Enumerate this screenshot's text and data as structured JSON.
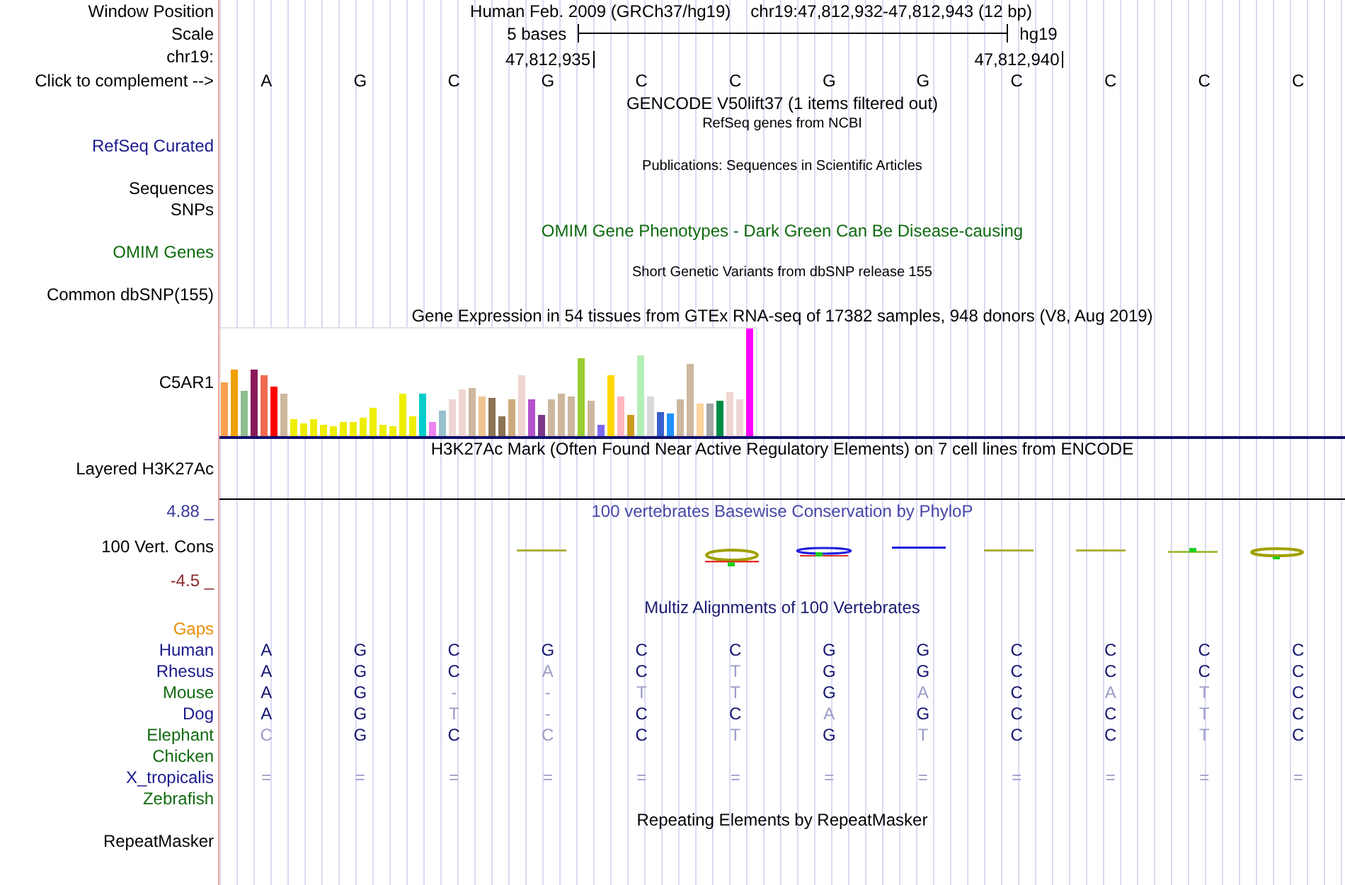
{
  "header": {
    "window_label": "Window Position",
    "assembly_title": "Human Feb. 2009 (GRCh37/hg19)",
    "position": "chr19:47,812,932-47,812,943 (12 bp)",
    "scale_label": "Scale",
    "scale_text": "5 bases",
    "assembly": "hg19",
    "chrom_label": "chr19:",
    "ticks": [
      {
        "label": "47,812,935"
      },
      {
        "label": "47,812,940"
      }
    ],
    "complement_label": "Click to complement -->",
    "bases": [
      "A",
      "G",
      "C",
      "G",
      "C",
      "C",
      "G",
      "G",
      "C",
      "C",
      "C",
      "C"
    ]
  },
  "tracks": [
    {
      "kind": "title",
      "text": "GENCODE V50lift37 (1 items filtered out)"
    },
    {
      "kind": "subtitle",
      "text": "RefSeq genes from NCBI"
    },
    {
      "kind": "label",
      "label": "RefSeq Curated",
      "color": "#1a1a8c"
    },
    {
      "kind": "subtitle",
      "text": "Publications: Sequences in Scientific Articles"
    },
    {
      "kind": "label",
      "label": "Sequences"
    },
    {
      "kind": "label",
      "label": "SNPs"
    },
    {
      "kind": "title",
      "text": "OMIM Gene Phenotypes - Dark Green Can Be Disease-causing",
      "color": "#0f6b0f"
    },
    {
      "kind": "label",
      "label": "OMIM Genes",
      "color": "#0f6b0f"
    },
    {
      "kind": "subtitle",
      "text": "Short Genetic Variants from dbSNP release 155"
    },
    {
      "kind": "label",
      "label": "Common dbSNP(155)"
    },
    {
      "kind": "title",
      "text": "Gene Expression in 54 tissues from GTEx RNA-seq of 17382 samples, 948 donors (V8, Aug 2019)"
    },
    {
      "kind": "expression",
      "label": "C5AR1"
    },
    {
      "kind": "title",
      "text": "H3K27Ac Mark (Often Found Near Active Regulatory Elements) on 7 cell lines from ENCODE"
    },
    {
      "kind": "layered",
      "label": "Layered H3K27Ac"
    },
    {
      "kind": "conservation",
      "label": "100 Vert. Cons",
      "title": "100 vertebrates Basewise Conservation by PhyloP",
      "max": "4.88 _",
      "min": "-4.5 _"
    },
    {
      "kind": "title",
      "text": "Multiz Alignments of 100 Vertebrates",
      "color": "#1a1a70"
    },
    {
      "kind": "label",
      "label": "Gaps",
      "color": "#e8900a"
    },
    {
      "kind": "alignment",
      "label": "Human",
      "color": "#1a1a8c",
      "bases": [
        {
          "base": "A",
          "match": true
        },
        {
          "base": "G",
          "match": true
        },
        {
          "base": "C",
          "match": true
        },
        {
          "base": "G",
          "match": true
        },
        {
          "base": "C",
          "match": true
        },
        {
          "base": "C",
          "match": true
        },
        {
          "base": "G",
          "match": true
        },
        {
          "base": "G",
          "match": true
        },
        {
          "base": "C",
          "match": true
        },
        {
          "base": "C",
          "match": true
        },
        {
          "base": "C",
          "match": true
        },
        {
          "base": "C",
          "match": true
        }
      ]
    },
    {
      "kind": "alignment",
      "label": "Rhesus",
      "color": "#1a1a8c",
      "bases": [
        {
          "base": "A",
          "match": true
        },
        {
          "base": "G",
          "match": true
        },
        {
          "base": "C",
          "match": true
        },
        {
          "base": "A",
          "match": false
        },
        {
          "base": "C",
          "match": true
        },
        {
          "base": "T",
          "match": false
        },
        {
          "base": "G",
          "match": true
        },
        {
          "base": "G",
          "match": true
        },
        {
          "base": "C",
          "match": true
        },
        {
          "base": "C",
          "match": true
        },
        {
          "base": "C",
          "match": true
        },
        {
          "base": "C",
          "match": true
        }
      ]
    },
    {
      "kind": "alignment",
      "label": "Mouse",
      "color": "#0f6b0f",
      "bases": [
        {
          "base": "A",
          "match": true
        },
        {
          "base": "G",
          "match": true
        },
        {
          "base": "-",
          "match": false
        },
        {
          "base": "-",
          "match": false
        },
        {
          "base": "T",
          "match": false
        },
        {
          "base": "T",
          "match": false
        },
        {
          "base": "G",
          "match": true
        },
        {
          "base": "A",
          "match": false
        },
        {
          "base": "C",
          "match": true
        },
        {
          "base": "A",
          "match": false
        },
        {
          "base": "T",
          "match": false
        },
        {
          "base": "C",
          "match": true
        }
      ]
    },
    {
      "kind": "alignment",
      "label": "Dog",
      "color": "#1a1a8c",
      "bases": [
        {
          "base": "A",
          "match": true
        },
        {
          "base": "G",
          "match": true
        },
        {
          "base": "T",
          "match": false
        },
        {
          "base": "-",
          "match": false
        },
        {
          "base": "C",
          "match": true
        },
        {
          "base": "C",
          "match": true
        },
        {
          "base": "A",
          "match": false
        },
        {
          "base": "G",
          "match": true
        },
        {
          "base": "C",
          "match": true
        },
        {
          "base": "C",
          "match": true
        },
        {
          "base": "T",
          "match": false
        },
        {
          "base": "C",
          "match": true
        }
      ]
    },
    {
      "kind": "alignment",
      "label": "Elephant",
      "color": "#0f6b0f",
      "bases": [
        {
          "base": "C",
          "match": false
        },
        {
          "base": "G",
          "match": true
        },
        {
          "base": "C",
          "match": true
        },
        {
          "base": "C",
          "match": false
        },
        {
          "base": "C",
          "match": true
        },
        {
          "base": "T",
          "match": false
        },
        {
          "base": "G",
          "match": true
        },
        {
          "base": "T",
          "match": false
        },
        {
          "base": "C",
          "match": true
        },
        {
          "base": "C",
          "match": true
        },
        {
          "base": "T",
          "match": false
        },
        {
          "base": "C",
          "match": true
        }
      ]
    },
    {
      "kind": "alignment",
      "label": "Chicken",
      "color": "#0f6b0f"
    },
    {
      "kind": "alignment",
      "label": "X_tropicalis",
      "color": "#1a1a8c",
      "bases": [
        {
          "base": "=",
          "match": false
        },
        {
          "base": "=",
          "match": false
        },
        {
          "base": "=",
          "match": false
        },
        {
          "base": "=",
          "match": false
        },
        {
          "base": "=",
          "match": false
        },
        {
          "base": "=",
          "match": false
        },
        {
          "base": "=",
          "match": false
        },
        {
          "base": "=",
          "match": false
        },
        {
          "base": "=",
          "match": false
        },
        {
          "base": "=",
          "match": false
        },
        {
          "base": "=",
          "match": false
        },
        {
          "base": "=",
          "match": false
        }
      ]
    },
    {
      "kind": "alignment",
      "label": "Zebrafish",
      "color": "#0f6b0f"
    },
    {
      "kind": "title",
      "text": "Repeating Elements by RepeatMasker"
    },
    {
      "kind": "label",
      "label": "RepeatMasker"
    }
  ]
}
